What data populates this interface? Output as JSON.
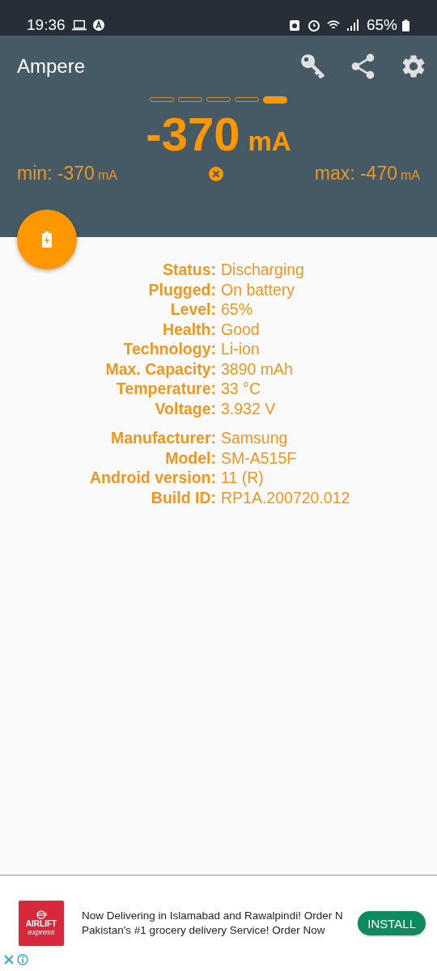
{
  "status_bar": {
    "time": "19:36",
    "battery": "65%"
  },
  "app_bar": {
    "title": "Ampere"
  },
  "pager": [
    {
      "selected": false
    },
    {
      "selected": false
    },
    {
      "selected": false
    },
    {
      "selected": false
    },
    {
      "selected": true
    }
  ],
  "current": {
    "value": "-370",
    "unit": "mA"
  },
  "min": {
    "label": "min:",
    "value": "-370",
    "unit": "mA"
  },
  "max": {
    "label": "max:",
    "value": "-470",
    "unit": "mA"
  },
  "battery_info": [
    {
      "label": "Status:",
      "value": "Discharging"
    },
    {
      "label": "Plugged:",
      "value": "On battery"
    },
    {
      "label": "Level:",
      "value": "65%"
    },
    {
      "label": "Health:",
      "value": "Good"
    },
    {
      "label": "Technology:",
      "value": "Li-ion"
    },
    {
      "label": "Max. Capacity:",
      "value": "3890 mAh"
    },
    {
      "label": "Temperature:",
      "value": "33 °C"
    },
    {
      "label": "Voltage:",
      "value": "3.932 V"
    }
  ],
  "device_info": [
    {
      "label": "Manufacturer:",
      "value": "Samsung"
    },
    {
      "label": "Model:",
      "value": "SM-A515F"
    },
    {
      "label": "Android version:",
      "value": "11 (R)"
    },
    {
      "label": "Build ID:",
      "value": "RP1A.200720.012"
    }
  ],
  "ad": {
    "logo_name": "AIRLIFT",
    "logo_tagline": "express",
    "line_1": "Now Delivering in Islamabad and Rawalpindi! Order N",
    "line_2": "Pakistan's #1 grocery delivery Service! Order Now",
    "button": "INSTALL"
  }
}
